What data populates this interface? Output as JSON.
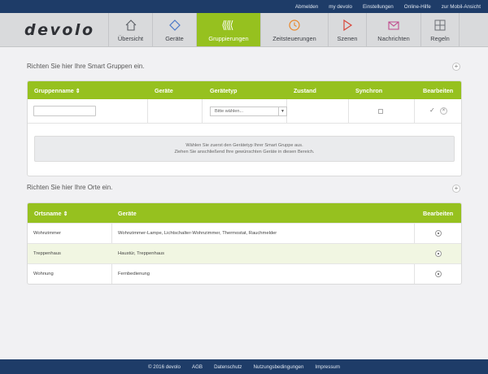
{
  "top_links": [
    "Abmelden",
    "my devolo",
    "Einstellungen",
    "Online-Hilfe",
    "zur Mobil-Ansicht"
  ],
  "logo_text": "devolo",
  "nav": {
    "tabs": [
      {
        "label": "Übersicht",
        "icon": "home-icon"
      },
      {
        "label": "Geräte",
        "icon": "diamond-icon"
      },
      {
        "label": "Gruppierungen",
        "icon": "groups-icon",
        "active": true
      },
      {
        "label": "Zeitsteuerungen",
        "icon": "clock-icon"
      },
      {
        "label": "Szenen",
        "icon": "play-icon"
      },
      {
        "label": "Nachrichten",
        "icon": "envelope-icon"
      },
      {
        "label": "Regeln",
        "icon": "rules-icon"
      }
    ]
  },
  "groups": {
    "title": "Richten Sie hier Ihre Smart Gruppen ein.",
    "columns": [
      "Gruppenname",
      "Geräte",
      "Gerätetyp",
      "Zustand",
      "Synchron",
      "Bearbeiten"
    ],
    "sort_glyph": "⇕",
    "name_placeholder": "",
    "type_select_value": "Bitte wählen...",
    "info_line1": "Wählen Sie zuerst den Gerätetyp Ihrer Smart Gruppe aus.",
    "info_line2": "Ziehen Sie anschließend Ihre gewünschten Geräte in diesen Bereich."
  },
  "places": {
    "title": "Richten Sie hier Ihre Orte ein.",
    "columns": [
      "Ortsname",
      "Geräte",
      "Bearbeiten"
    ],
    "sort_glyph": "⇕",
    "rows": [
      {
        "name": "Wohnzimmer",
        "devices": "Wohnzimmer-Lampe, Lichtschalter-Wohnzimmer, Thermostat, Rauchmelder"
      },
      {
        "name": "Treppenhaus",
        "devices": "Haustür, Treppenhaus"
      },
      {
        "name": "Wohnung",
        "devices": "Fernbedienung"
      }
    ]
  },
  "footer": [
    "© 2016 devolo",
    "AGB",
    "Datenschutz",
    "Nutzungsbedingungen",
    "Impressum"
  ],
  "colors": {
    "accent": "#96c11f",
    "topbar": "#1e3c68",
    "nav_bg": "#d9dadc"
  }
}
